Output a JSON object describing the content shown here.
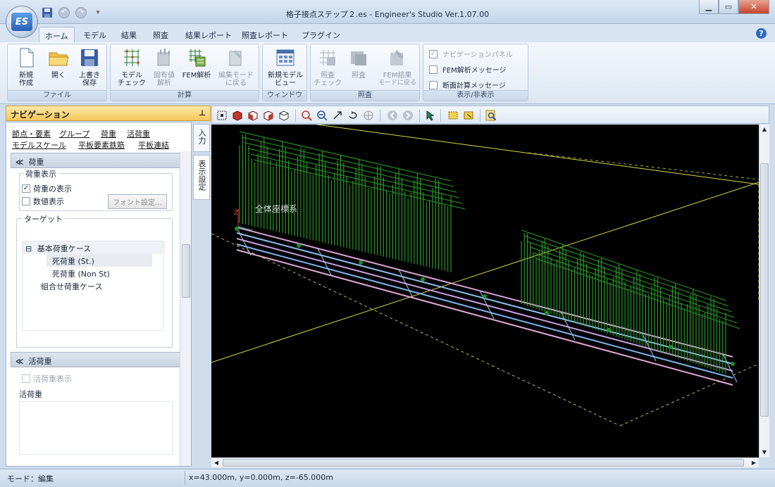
{
  "window": {
    "title": "格子接点ステップ２.es - Engineer's Studio Ver.1.07.00",
    "logo_text": "ES"
  },
  "tabs": [
    {
      "label": "ホーム",
      "active": true
    },
    {
      "label": "モデル"
    },
    {
      "label": "結果"
    },
    {
      "label": "照査"
    },
    {
      "label": "結果レポート"
    },
    {
      "label": "照査レポート"
    },
    {
      "label": "プラグイン"
    }
  ],
  "ribbon": {
    "file": {
      "label": "ファイル",
      "new": [
        "新規",
        "作成"
      ],
      "open": [
        "開く",
        ""
      ],
      "save": [
        "上書き",
        "保存"
      ]
    },
    "calc": {
      "label": "計算",
      "model_check": [
        "モデル",
        "チェック"
      ],
      "eigen": [
        "固有値",
        "解析"
      ],
      "fem": [
        "FEM解析",
        ""
      ],
      "back_to_edit": [
        "編集モード",
        "に戻る"
      ]
    },
    "window": {
      "label": "ウィンドウ",
      "new_view": [
        "新規モデル",
        "ビュー"
      ]
    },
    "check": {
      "label": "照査",
      "check_check": [
        "照査",
        "チェック"
      ],
      "check": [
        "照査",
        ""
      ],
      "back_to_fem": [
        "FEM結果",
        "モードに戻る"
      ]
    },
    "display": {
      "label": "表示/非表示",
      "nav_panel": "ナビゲーションパネル",
      "fem_msg": "FEM解析メッセージ",
      "section_msg": "断面計算メッセージ"
    }
  },
  "navigation": {
    "title": "ナビゲーション",
    "links_row1": [
      "節点・要素",
      "グループ",
      "荷重",
      "活荷重"
    ],
    "links_row2": [
      "モデルスケール",
      "平板要素鉄筋",
      "平板連結"
    ],
    "side_tabs": [
      "入力",
      "表示設定"
    ],
    "load_section": {
      "header": "荷重",
      "display_legend": "荷重表示",
      "show_load": "荷重の表示",
      "show_values": "数値表示",
      "font_button": "フォント設定...",
      "target_legend": "ターゲット",
      "tree": {
        "root": "基本荷重ケース",
        "child1": "死荷重 (St.)",
        "child2": "死荷重 (Non St)",
        "combo": "組合せ荷重ケース"
      }
    },
    "live_section": {
      "header": "活荷重",
      "show_live": "活荷重表示",
      "label": "活荷重"
    }
  },
  "viewport": {
    "axis_label": "Z",
    "caption": "全体座標系"
  },
  "status": {
    "mode": "モード：編集",
    "coords": "x=43.000m, y=0.000m, z=-65.000m"
  }
}
